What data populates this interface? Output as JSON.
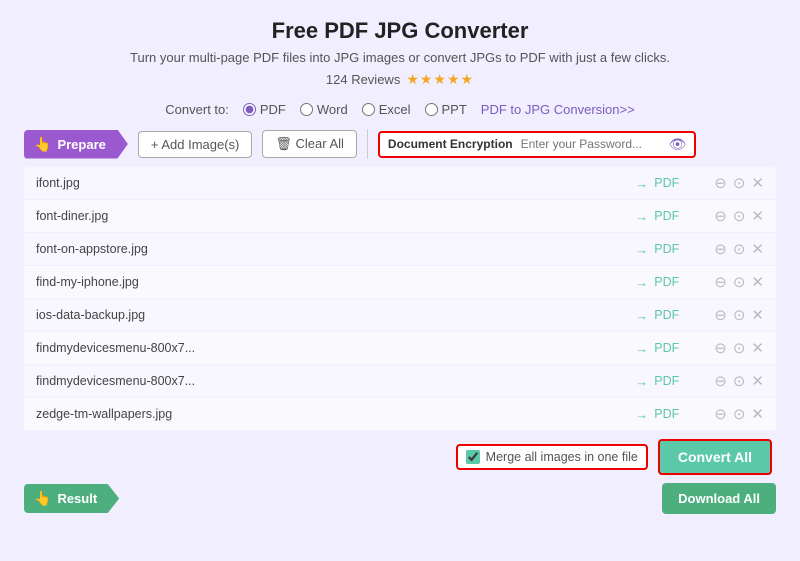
{
  "header": {
    "title": "Free PDF JPG Converter",
    "subtitle": "Turn your multi-page PDF files into JPG images or convert JPGs to PDF with just a few clicks.",
    "reviews_count": "124 Reviews",
    "stars": "★★★★★"
  },
  "convert_to": {
    "label": "Convert to:",
    "options": [
      "PDF",
      "Word",
      "Excel",
      "PPT"
    ],
    "selected": "PDF",
    "link_label": "PDF to JPG Conversion>>",
    "link_href": "#"
  },
  "toolbar": {
    "prepare_label": "Prepare",
    "add_image_label": "+ Add Image(s)",
    "clear_all_label": "🗑 Clear All",
    "encryption_label": "Document Encryption",
    "password_placeholder": "Enter your Password..."
  },
  "files": [
    {
      "name": "ifont.jpg",
      "dest": "PDF"
    },
    {
      "name": "font-diner.jpg",
      "dest": "PDF"
    },
    {
      "name": "font-on-appstore.jpg",
      "dest": "PDF"
    },
    {
      "name": "find-my-iphone.jpg",
      "dest": "PDF"
    },
    {
      "name": "ios-data-backup.jpg",
      "dest": "PDF"
    },
    {
      "name": "findmydevicesmenu-800x7...",
      "dest": "PDF"
    },
    {
      "name": "findmydevicesmenu-800x7...",
      "dest": "PDF"
    },
    {
      "name": "zedge-tm-wallpapers.jpg",
      "dest": "PDF"
    }
  ],
  "bottom": {
    "merge_label": "Merge all images in one file",
    "convert_all_label": "Convert All"
  },
  "result": {
    "label": "Result",
    "download_all_label": "Download All"
  }
}
